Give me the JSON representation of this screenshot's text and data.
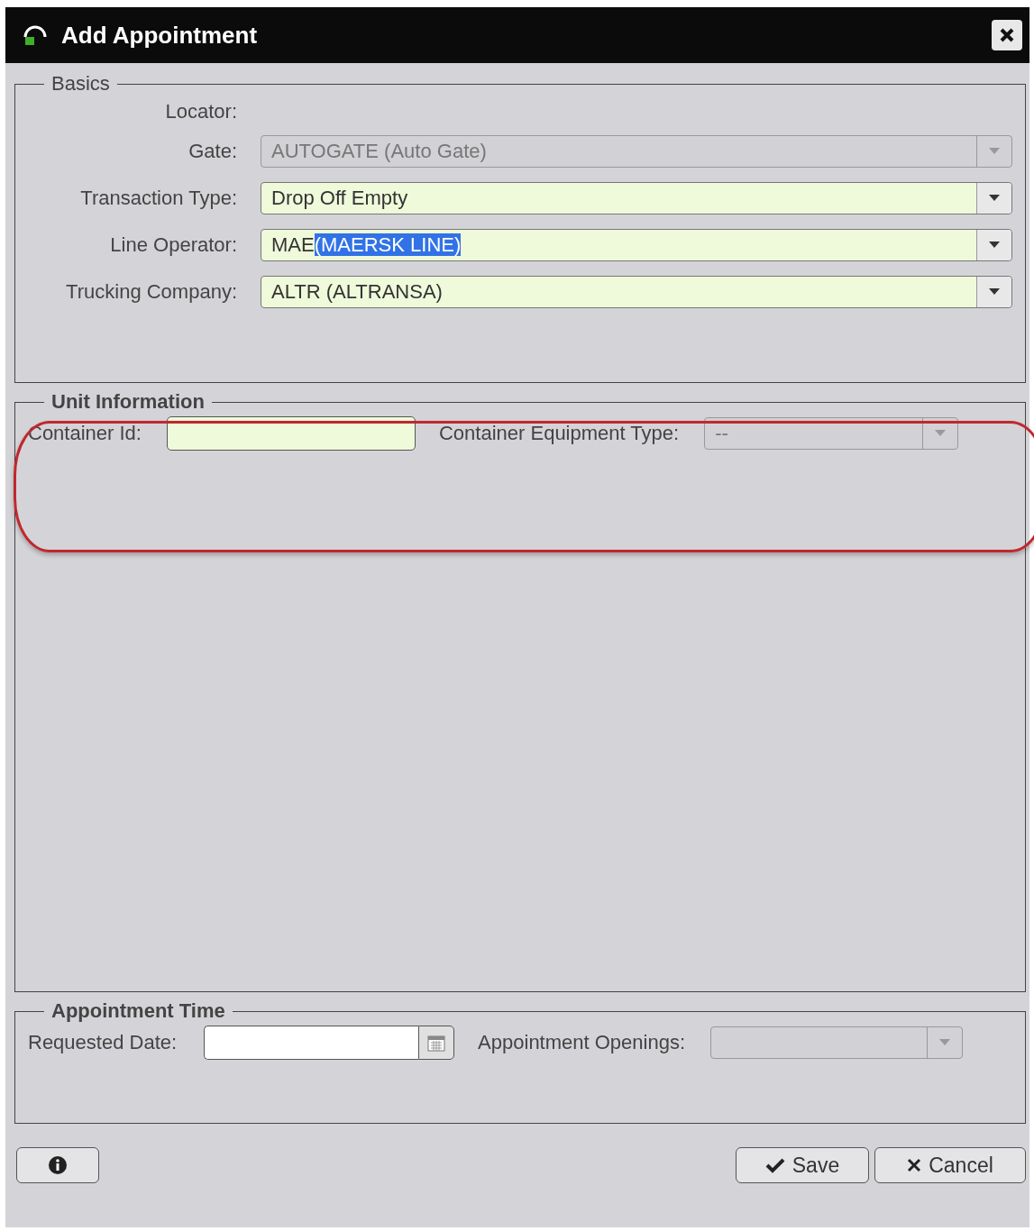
{
  "window": {
    "title": "Add Appointment"
  },
  "basics": {
    "legend": "Basics",
    "fields": [
      {
        "kind": "label",
        "label": "Locator:"
      },
      {
        "kind": "combo",
        "label": "Gate:",
        "value": "AUTOGATE (Auto Gate)",
        "disabled": true,
        "required": false
      },
      {
        "kind": "combo",
        "label": "Transaction Type:",
        "value": "Drop Off Empty",
        "disabled": false,
        "required": true
      },
      {
        "kind": "combo",
        "label": "Line Operator:",
        "value": "MAE",
        "selected_text": "(MAERSK LINE)",
        "disabled": false,
        "required": true
      },
      {
        "kind": "combo",
        "label": "Trucking Company:",
        "value": "ALTR (ALTRANSA)",
        "disabled": false,
        "required": true
      }
    ]
  },
  "unit_information": {
    "legend": "Unit Information",
    "highlighted": true,
    "container_id": {
      "label": "Container Id:",
      "required": true
    },
    "equipment_type": {
      "label": "Container Equipment Type:",
      "value": "--",
      "disabled": true
    }
  },
  "appointment_time": {
    "legend": "Appointment Time",
    "requested_date": {
      "label": "Requested Date:"
    },
    "openings": {
      "label": "Appointment Openings:",
      "disabled": true
    }
  },
  "buttons": [
    {
      "kind": "info"
    },
    {
      "kind": "save",
      "label": "Save"
    },
    {
      "kind": "cancel",
      "label": "Cancel"
    }
  ]
}
